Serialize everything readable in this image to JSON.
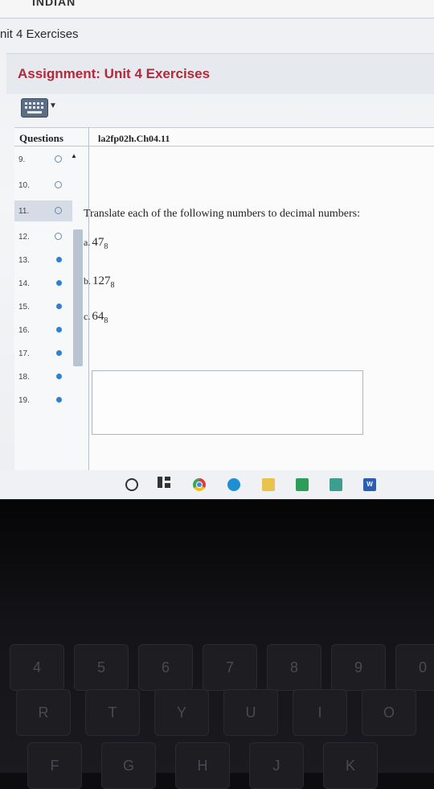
{
  "header": {
    "brand": "INDIAN",
    "breadcrumb": "nit 4 Exercises",
    "assignment_title": "Assignment: Unit 4 Exercises"
  },
  "toolbar": {
    "keyboard_icon": "keyboard-icon",
    "dropdown_icon": "caret-down-icon"
  },
  "questions": {
    "header": "Questions",
    "items": [
      {
        "num": "9.",
        "status": "open"
      },
      {
        "num": "10.",
        "status": "open"
      },
      {
        "num": "11.",
        "status": "open"
      },
      {
        "num": "12.",
        "status": "open"
      },
      {
        "num": "13.",
        "status": "done"
      },
      {
        "num": "14.",
        "status": "done"
      },
      {
        "num": "15.",
        "status": "done"
      },
      {
        "num": "16.",
        "status": "done"
      },
      {
        "num": "17.",
        "status": "done"
      },
      {
        "num": "18.",
        "status": "done"
      },
      {
        "num": "19.",
        "status": "done"
      }
    ]
  },
  "content": {
    "question_id": "la2fp02h.Ch04.11",
    "prompt": "Translate each of the following numbers to decimal numbers:",
    "parts": [
      {
        "label": "a.",
        "value": "47",
        "base": "8"
      },
      {
        "label": "b.",
        "value": "127",
        "base": "8"
      },
      {
        "label": "c.",
        "value": "64",
        "base": "8"
      }
    ],
    "answer_value": ""
  },
  "taskbar": {
    "word_label": "W"
  },
  "keyboard": {
    "row1": [
      "4",
      "5",
      "6",
      "7",
      "8",
      "9",
      "0"
    ],
    "row2": [
      "R",
      "T",
      "Y",
      "U",
      "I",
      "O"
    ],
    "row3": [
      "F",
      "G",
      "H",
      "J",
      "K"
    ]
  },
  "colors": {
    "title_red": "#b3283a",
    "done_dot": "#2f7fd2",
    "open_dot": "#6e86a8"
  }
}
